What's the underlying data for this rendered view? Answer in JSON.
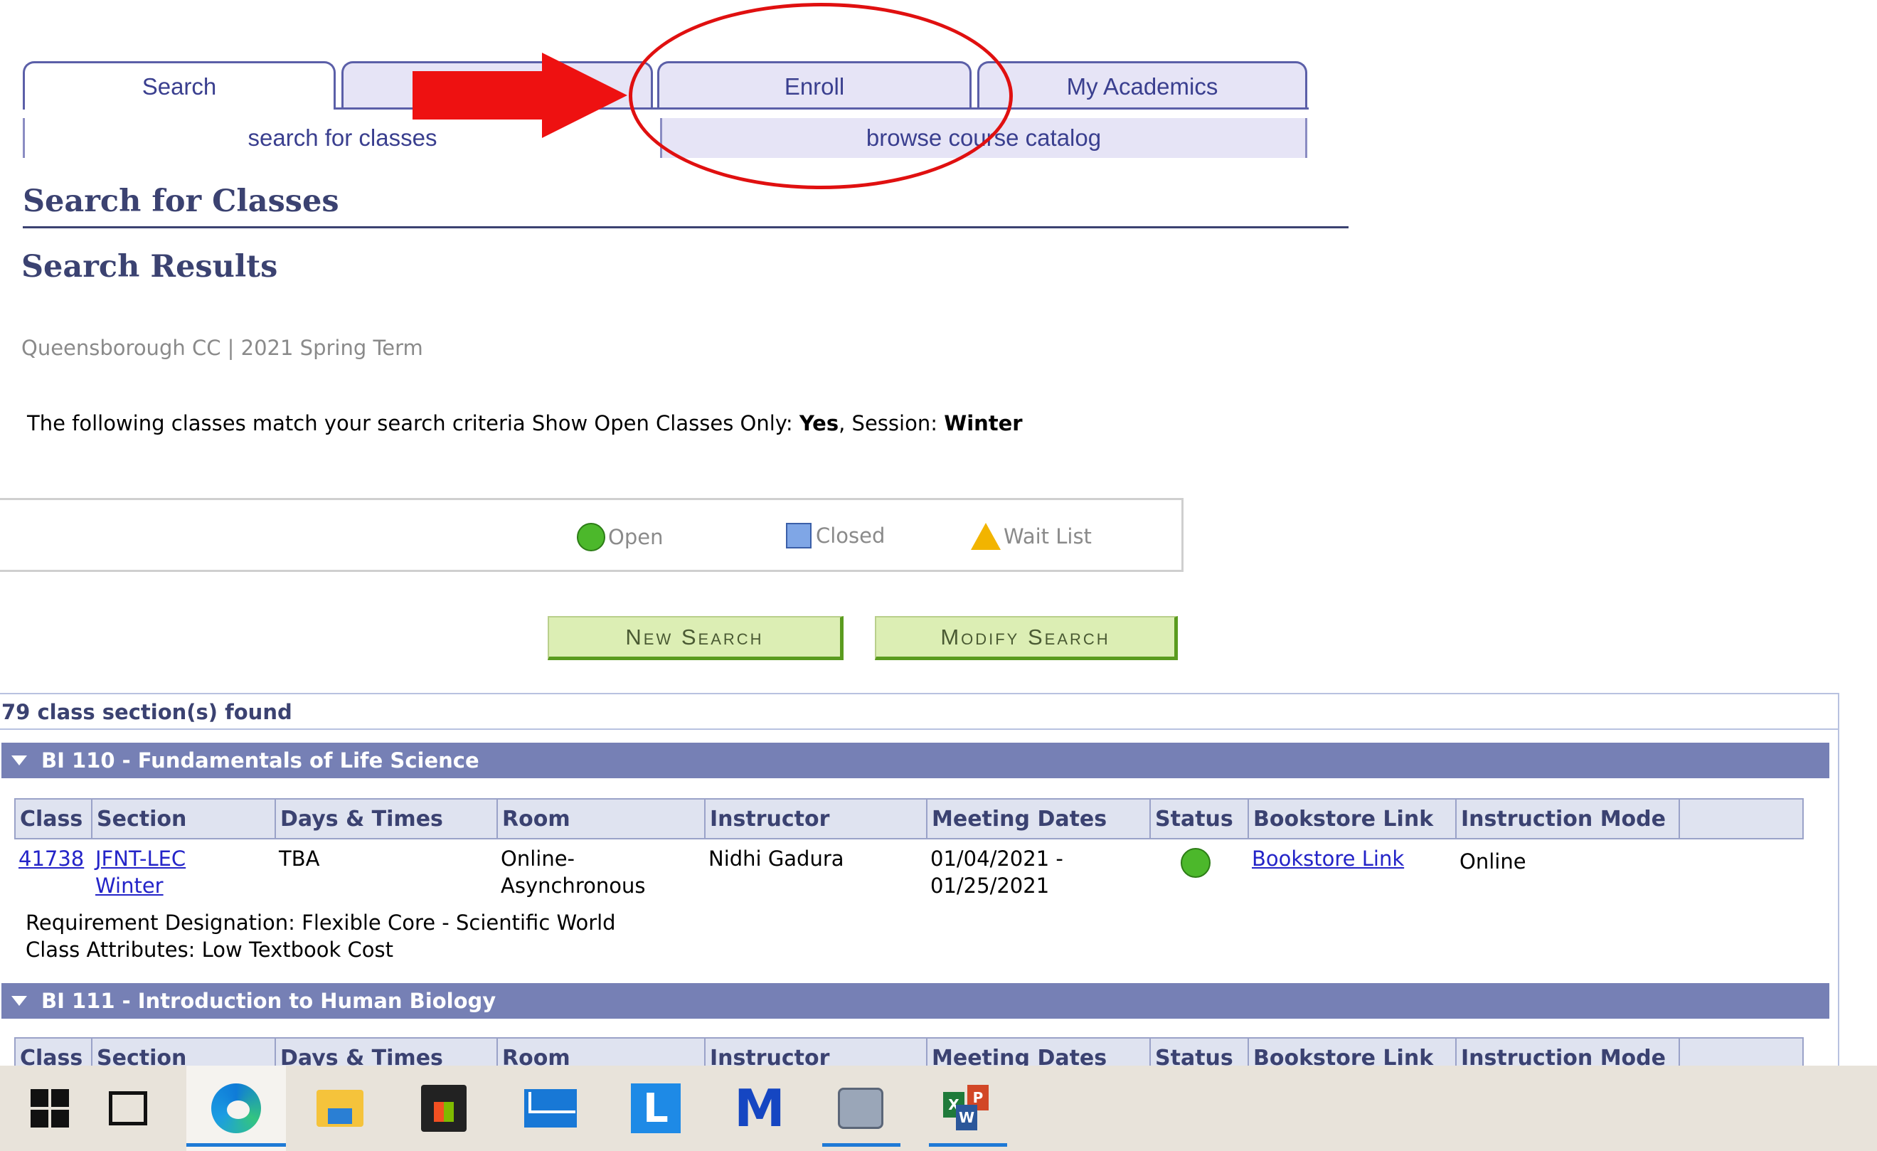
{
  "tabs": {
    "search": "Search",
    "plan": "",
    "enroll": "Enroll",
    "my_academics": "My Academics"
  },
  "subtabs": {
    "search_for_classes": "search for classes",
    "browse_catalog": "browse course catalog"
  },
  "headings": {
    "page_title": "Search for Classes",
    "section_title": "Search Results"
  },
  "institution_term": "Queensborough CC | 2021 Spring Term",
  "criteria": {
    "prefix": "The following classes match your search criteria Show Open Classes Only: ",
    "open_only_value": "Yes",
    "session_label": ",  Session: ",
    "session_value": "Winter"
  },
  "legend": {
    "open": "Open",
    "closed": "Closed",
    "wait_list": "Wait List"
  },
  "buttons": {
    "new_search": "New Search",
    "modify_search": "Modify Search"
  },
  "results": {
    "count_text": "79 class section(s) found",
    "columns": [
      "Class",
      "Section",
      "Days & Times",
      "Room",
      "Instructor",
      "Meeting Dates",
      "Status",
      "Bookstore Link",
      "Instruction Mode"
    ],
    "courses": [
      {
        "title": "BI 110 - Fundamentals of Life Science",
        "sections": [
          {
            "class_nbr": "41738",
            "section_line1": "JFNT-LEC",
            "section_line2": "Winter",
            "days_times": "TBA",
            "room_line1": "Online-",
            "room_line2": "Asynchronous",
            "instructor": "Nidhi Gadura",
            "dates_line1": "01/04/2021 -",
            "dates_line2": "01/25/2021",
            "status": "Open",
            "bookstore": "Bookstore Link",
            "mode": "Online",
            "requirement": "Requirement Designation: Flexible Core - Scientific World",
            "attributes": "Class Attributes: Low Textbook Cost"
          }
        ]
      },
      {
        "title": "BI 111 - Introduction to Human Biology"
      }
    ]
  },
  "colors": {
    "tab_border": "#5b5fa8",
    "heading": "#3b4271",
    "course_header_bg": "#7680b5",
    "button_bg": "#dceeb4",
    "annotation_red": "#ee1111",
    "status_open": "#4cb82b"
  },
  "taskbar": {
    "items": [
      "windows-start-icon",
      "task-view-icon",
      "edge-icon",
      "file-explorer-icon",
      "store-icon",
      "mail-icon",
      "l-app-icon",
      "malwarebytes-icon",
      "printer-app-icon",
      "office-icon"
    ]
  }
}
